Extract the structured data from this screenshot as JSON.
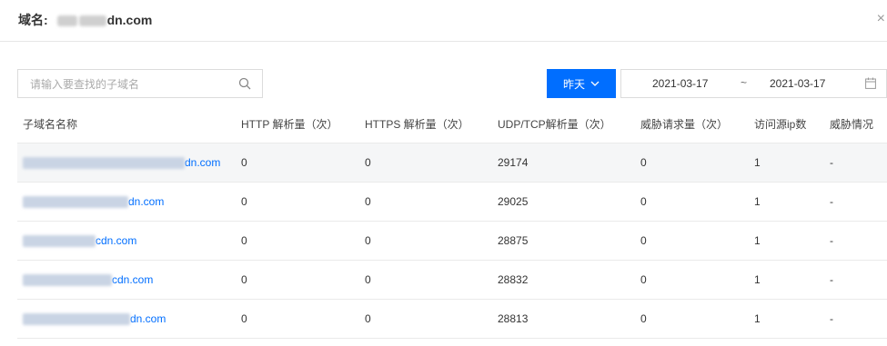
{
  "dialog": {
    "title_label": "域名:",
    "title_visible_suffix": "dn.com",
    "close_glyph": "×"
  },
  "search": {
    "placeholder": "请输入要查找的子域名",
    "value": ""
  },
  "range_button": {
    "label": "昨天"
  },
  "date_range": {
    "start": "2021-03-17",
    "separator": "~",
    "end": "2021-03-17"
  },
  "table": {
    "headers": [
      "子域名名称",
      "HTTP 解析量（次）",
      "HTTPS 解析量（次）",
      "UDP/TCP解析量（次）",
      "威胁请求量（次）",
      "访问源ip数",
      "威胁情况"
    ],
    "rows": [
      {
        "domain_suffix": "dn.com",
        "http": "0",
        "https": "0",
        "udp_tcp": "29174",
        "threat_req": "0",
        "source_ip": "1",
        "threat": "-"
      },
      {
        "domain_suffix": "dn.com",
        "http": "0",
        "https": "0",
        "udp_tcp": "29025",
        "threat_req": "0",
        "source_ip": "1",
        "threat": "-"
      },
      {
        "domain_suffix": "cdn.com",
        "http": "0",
        "https": "0",
        "udp_tcp": "28875",
        "threat_req": "0",
        "source_ip": "1",
        "threat": "-"
      },
      {
        "domain_suffix": "cdn.com",
        "http": "0",
        "https": "0",
        "udp_tcp": "28832",
        "threat_req": "0",
        "source_ip": "1",
        "threat": "-"
      },
      {
        "domain_suffix": "dn.com",
        "http": "0",
        "https": "0",
        "udp_tcp": "28813",
        "threat_req": "0",
        "source_ip": "1",
        "threat": "-"
      }
    ]
  },
  "colors": {
    "accent": "#006eff",
    "link": "#006eff",
    "border": "#dcdcdc"
  },
  "icons": {
    "search": "search-icon",
    "dropdown": "chevron-down-icon",
    "calendar": "calendar-icon",
    "close": "close-icon"
  }
}
